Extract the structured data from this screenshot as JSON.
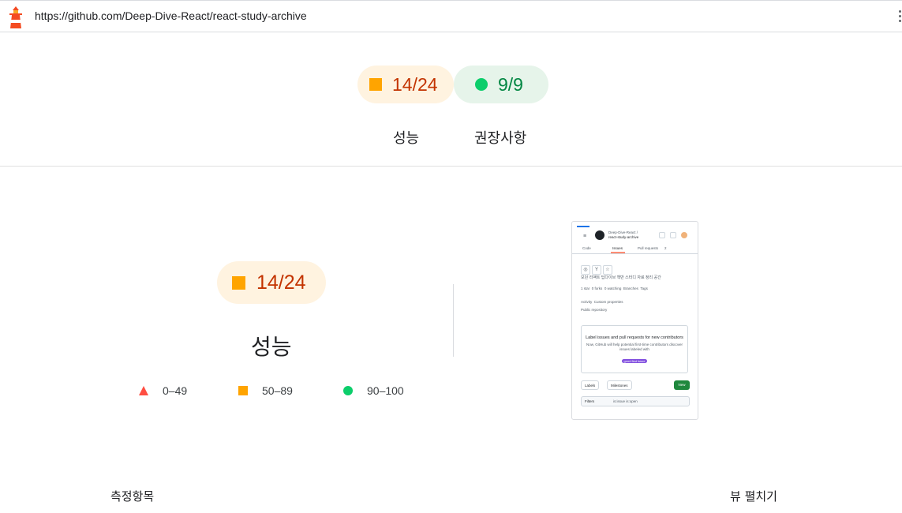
{
  "browser": {
    "url": "https://github.com/Deep-Dive-React/react-study-archive",
    "icon": "lighthouse-icon"
  },
  "summary": {
    "performance": {
      "score": "14/24",
      "label": "성능",
      "status": "average",
      "color": "#ffa400"
    },
    "best_practices": {
      "score": "9/9",
      "label": "권장사항",
      "status": "pass",
      "color": "#0cce6b"
    }
  },
  "category": {
    "score": "14/24",
    "title": "성능"
  },
  "legend": [
    {
      "range": "0–49",
      "shape": "triangle",
      "color": "#ff4e42"
    },
    {
      "range": "50–89",
      "shape": "square",
      "color": "#ffa400"
    },
    {
      "range": "90–100",
      "shape": "circle",
      "color": "#0cce6b"
    }
  ],
  "screenshot": {
    "repo_owner": "Deep-Dive-React /",
    "repo_name": "react-study-archive",
    "tabs": [
      "Code",
      "Issues",
      "Pull requests",
      "2"
    ],
    "description": "모던 리액트 딥다이브 책반 스터디 자료 정리 공간",
    "stats": [
      "1 star",
      "0 forks",
      "0 watching",
      "Branches",
      "Tags"
    ],
    "meta": [
      "Activity",
      "Custom properties",
      "Public repository"
    ],
    "card_title": "Label issues and pull requests for new contributors",
    "card_body": "Now, GitHub will help potential first-time contributors discover issues labeled with",
    "card_badge": "good first issue",
    "labels_btn": "Labels",
    "milestones_btn": "Milestones",
    "new_btn": "New",
    "filters_btn": "Filters",
    "filter_query": "is:issue is:open"
  },
  "footer": {
    "left": "측정항목",
    "right": "뷰 펼치기"
  }
}
